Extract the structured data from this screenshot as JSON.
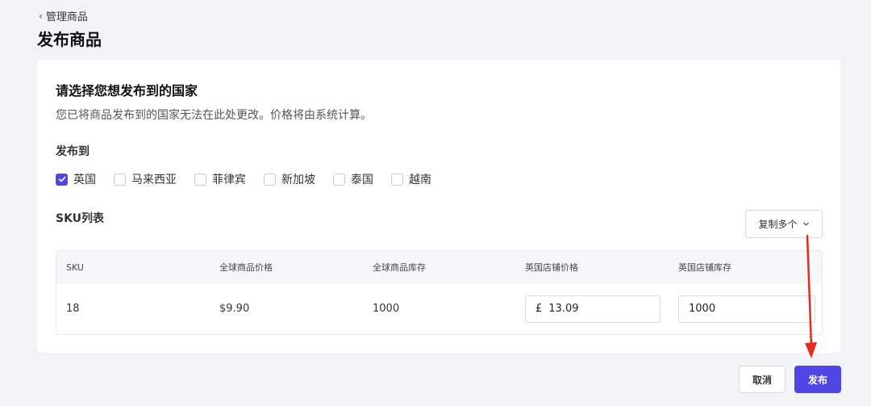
{
  "header": {
    "back_label": "管理商品",
    "title": "发布商品"
  },
  "card": {
    "title": "请选择您想发布到的国家",
    "description": "您已将商品发布到的国家无法在此处更改。价格将由系统计算。",
    "publish_to_label": "发布到",
    "countries": [
      {
        "label": "英国",
        "checked": true
      },
      {
        "label": "马来西亚",
        "checked": false
      },
      {
        "label": "菲律宾",
        "checked": false
      },
      {
        "label": "新加坡",
        "checked": false
      },
      {
        "label": "泰国",
        "checked": false
      },
      {
        "label": "越南",
        "checked": false
      }
    ],
    "sku_list_label": "SKU列表",
    "copy_button_label": "复制多个"
  },
  "table": {
    "headers": [
      "SKU",
      "全球商品价格",
      "全球商品库存",
      "英国店铺价格",
      "英国店铺库存"
    ],
    "rows": [
      {
        "sku": "18",
        "global_price": "$9.90",
        "global_stock": "1000",
        "uk_currency": "£",
        "uk_price": "13.09",
        "uk_stock": "1000"
      }
    ]
  },
  "footer": {
    "cancel_label": "取消",
    "publish_label": "发布"
  },
  "colors": {
    "accent": "#4f46e5",
    "annotation": "#e8291c"
  }
}
